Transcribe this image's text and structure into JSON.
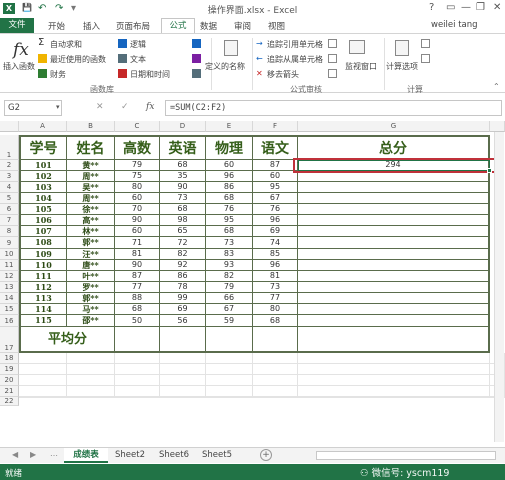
{
  "window": {
    "title": "操作界面.xlsx - Excel",
    "help": "?",
    "minimize": "—",
    "restore": "❐",
    "close": "✕",
    "user": "weilei tang"
  },
  "quick_access": {
    "save": "💾",
    "undo": "↶",
    "redo": "↷",
    "more": "▾"
  },
  "tabs": [
    "开始",
    "插入",
    "页面布局",
    "公式",
    "数据",
    "审阅",
    "视图"
  ],
  "file_tab": "文件",
  "active_tab": "公式",
  "ribbon": {
    "insert_function_icon": "fx",
    "insert_function": "插入函数",
    "autosum": "自动求和",
    "recent": "最近使用的函数",
    "financial": "财务",
    "logical": "逻辑",
    "text": "文本",
    "datetime": "日期和时间",
    "library_group": "函数库",
    "define_name": "定义的名称",
    "trace_precedents": "追踪引用单元格",
    "trace_dependents": "追踪从属单元格",
    "remove_arrows": "移去箭头",
    "audit_group": "公式审核",
    "watch_window": "监视窗口",
    "calc_options": "计算选项",
    "calc_group": "计算"
  },
  "formula_bar": {
    "name_box": "G2",
    "cancel": "✕",
    "enter": "✓",
    "fx": "fx",
    "formula": "=SUM(C2:F2)"
  },
  "columns": [
    "A",
    "B",
    "C",
    "D",
    "E",
    "F",
    "G"
  ],
  "header_row": [
    "学号",
    "姓名",
    "高数",
    "英语",
    "物理",
    "语文",
    "总分"
  ],
  "rows": [
    [
      "101",
      "黄**",
      "79",
      "68",
      "60",
      "87",
      "294"
    ],
    [
      "102",
      "周**",
      "75",
      "35",
      "96",
      "60",
      ""
    ],
    [
      "103",
      "吴**",
      "80",
      "90",
      "86",
      "95",
      ""
    ],
    [
      "104",
      "周**",
      "60",
      "73",
      "68",
      "67",
      ""
    ],
    [
      "105",
      "徐**",
      "70",
      "68",
      "76",
      "76",
      ""
    ],
    [
      "106",
      "高**",
      "90",
      "98",
      "95",
      "96",
      ""
    ],
    [
      "107",
      "林**",
      "60",
      "65",
      "68",
      "69",
      ""
    ],
    [
      "108",
      "郭**",
      "71",
      "72",
      "73",
      "74",
      ""
    ],
    [
      "109",
      "汪**",
      "81",
      "82",
      "83",
      "85",
      ""
    ],
    [
      "110",
      "唐**",
      "90",
      "92",
      "93",
      "96",
      ""
    ],
    [
      "111",
      "叶**",
      "87",
      "86",
      "82",
      "81",
      ""
    ],
    [
      "112",
      "罗**",
      "77",
      "78",
      "79",
      "73",
      ""
    ],
    [
      "113",
      "郭**",
      "88",
      "99",
      "66",
      "77",
      ""
    ],
    [
      "114",
      "马**",
      "68",
      "69",
      "67",
      "80",
      ""
    ],
    [
      "115",
      "邵**",
      "50",
      "56",
      "59",
      "68",
      ""
    ]
  ],
  "average_label": "平均分",
  "row_numbers": [
    "1",
    "2",
    "3",
    "4",
    "5",
    "6",
    "7",
    "8",
    "9",
    "10",
    "11",
    "12",
    "13",
    "14",
    "15",
    "16",
    "17",
    "18",
    "19",
    "20",
    "21",
    "22"
  ],
  "sheets": [
    "成绩表",
    "Sheet2",
    "Sheet6",
    "Sheet5"
  ],
  "active_sheet": "成绩表",
  "status": "就绪",
  "watermark": "微信号: yscm119",
  "colors": {
    "excel_green": "#217346",
    "table_border": "#5a6c4c",
    "header_text": "#355e1a",
    "selection": "#c0313a"
  }
}
